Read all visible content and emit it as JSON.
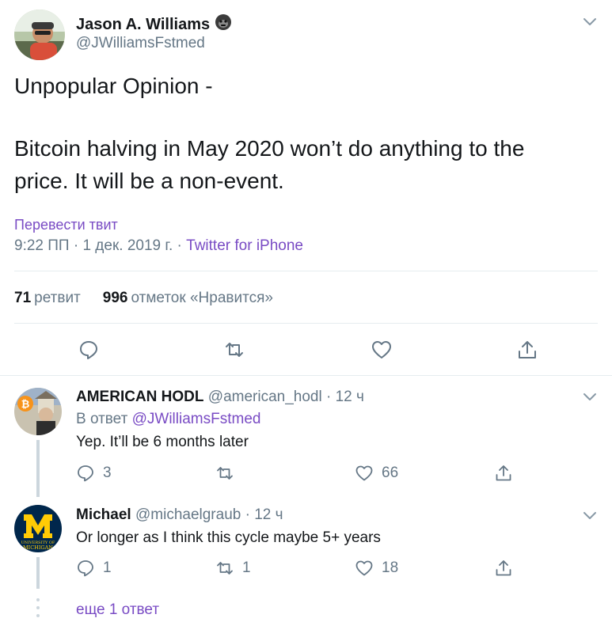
{
  "main_tweet": {
    "author_name": "Jason A. Williams",
    "author_handle": "@JWilliamsFstmed",
    "text_line1": "Unpopular Opinion -",
    "text_line2": "Bitcoin halving in May 2020 won’t do anything to the",
    "text_line3": "price.  It will be a non-event.",
    "translate_label": "Перевести твит",
    "timestamp": "9:22 ПП · 1 дек. 2019 г. · ",
    "source": "Twitter for iPhone",
    "retweet_count": "71",
    "retweet_label": "ретвит",
    "like_count": "996",
    "like_label": "отметок «Нравится»"
  },
  "replies": [
    {
      "name": "AMERICAN HODL",
      "handle": "@american_hodl · 12 ч",
      "reply_to_prefix": "В ответ ",
      "reply_to_handle": "@JWilliamsFstmed",
      "text": "Yep. It’ll be 6 months later",
      "reply_count": "3",
      "retweet_count": "",
      "like_count": "66"
    },
    {
      "name": "Michael",
      "handle": "@michaelgraub · 12 ч",
      "text": "Or longer as I think this cycle maybe 5+ years",
      "reply_count": "1",
      "retweet_count": "1",
      "like_count": "18",
      "avatar_text1": "UNIVERSITY OF",
      "avatar_text2": "MICHIGAN"
    }
  ],
  "more_replies_label": "еще 1 ответ",
  "colors": {
    "accent": "#794bc4",
    "secondary_text": "#657786",
    "divider": "#e6ecf0"
  }
}
